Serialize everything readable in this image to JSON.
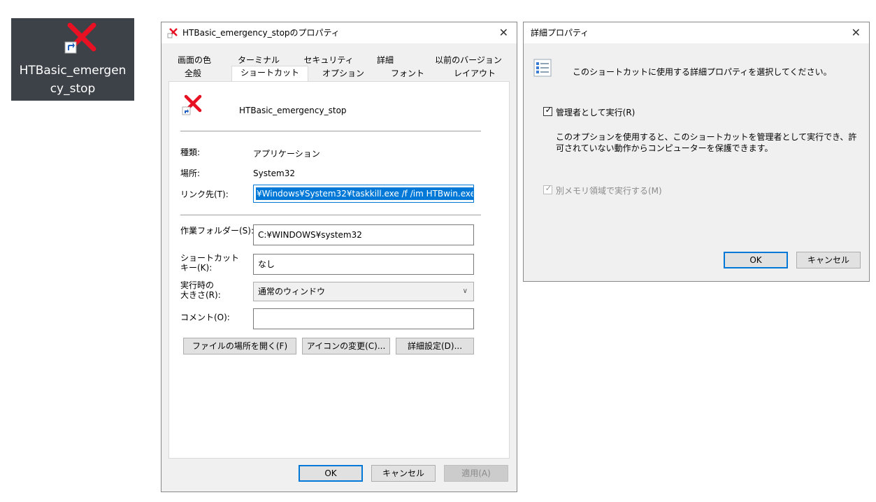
{
  "desktop_icon": {
    "label_line1": "HTBasic_emergen",
    "label_line2": "cy_stop"
  },
  "properties_window": {
    "title": "HTBasic_emergency_stopのプロパティ",
    "close_glyph": "✕",
    "tabs_row1": [
      "画面の色",
      "ターミナル",
      "セキュリティ",
      "詳細",
      "以前のバージョン"
    ],
    "tabs_row2": [
      "全般",
      "ショートカット",
      "オプション",
      "フォント",
      "レイアウト"
    ],
    "active_tab": "ショートカット",
    "shortcut_name": "HTBasic_emergency_stop",
    "type_label": "種類:",
    "type_value": "アプリケーション",
    "location_label": "場所:",
    "location_value": "System32",
    "target_label": "リンク先(T):",
    "target_value": "¥Windows¥System32¥taskkill.exe /f /im HTBwin.exe",
    "workdir_label": "作業フォルダー(S):",
    "workdir_value": "C:¥WINDOWS¥system32",
    "hotkey_label_line1": "ショートカット",
    "hotkey_label_line2": "キー(K):",
    "hotkey_value": "なし",
    "run_label_line1": "実行時の",
    "run_label_line2": "大きさ(R):",
    "run_value": "通常のウィンドウ",
    "comment_label": "コメント(O):",
    "comment_value": "",
    "open_location_button": "ファイルの場所を開く(F)",
    "change_icon_button": "アイコンの変更(C)...",
    "advanced_button": "詳細設定(D)...",
    "ok_button": "OK",
    "cancel_button": "キャンセル",
    "apply_button": "適用(A)"
  },
  "advanced_window": {
    "title": "詳細プロパティ",
    "close_glyph": "✕",
    "instruction": "このショートカットに使用する詳細プロパティを選択してください。",
    "run_as_admin_label": "管理者として実行(R)",
    "run_as_admin_checked": true,
    "description_line1": "このオプションを使用すると、このショートカットを管理者として実行でき、許",
    "description_line2": "可されていない動作からコンピューターを保護できます。",
    "separate_memory_label": "別メモリ領域で実行する(M)",
    "separate_memory_checked": true,
    "ok_button": "OK",
    "cancel_button": "キャンセル"
  },
  "colors": {
    "accent": "#0078d7",
    "error_x": "#e81123"
  }
}
